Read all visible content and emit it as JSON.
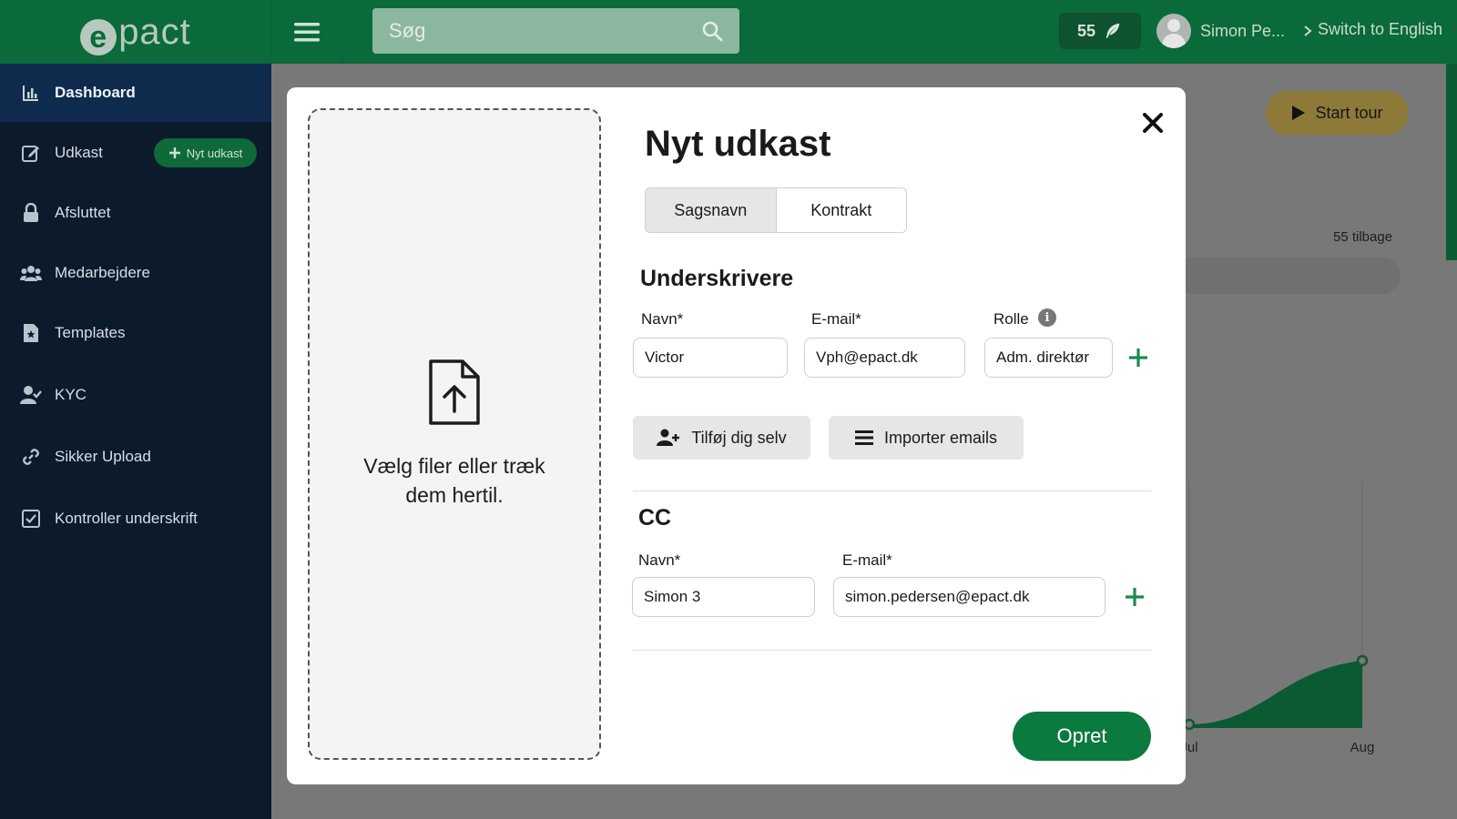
{
  "topbar": {
    "logo_text": "pact",
    "logo_mark": "e",
    "search_placeholder": "Søg",
    "credits": "55",
    "user_name": "Simon Pe...",
    "switch_language": "Switch to English"
  },
  "sidebar": {
    "items": [
      {
        "label": "Dashboard",
        "icon": "bar-chart-icon"
      },
      {
        "label": "Udkast",
        "icon": "edit-icon"
      },
      {
        "label": "Afsluttet",
        "icon": "lock-icon"
      },
      {
        "label": "Medarbejdere",
        "icon": "users-icon"
      },
      {
        "label": "Templates",
        "icon": "template-icon"
      },
      {
        "label": "KYC",
        "icon": "user-check-icon"
      },
      {
        "label": "Sikker Upload",
        "icon": "link-icon"
      },
      {
        "label": "Kontroller underskrift",
        "icon": "checkbox-icon"
      }
    ],
    "new_draft_button": "Nyt udkast"
  },
  "background": {
    "start_tour": "Start tour",
    "back_label": "55 tilbage",
    "chart_data": {
      "type": "area",
      "categories": [
        "Jul",
        "Aug"
      ],
      "values": [
        0,
        1
      ],
      "colors": {
        "fill": "#0b5a32",
        "line": "#0b5a32"
      }
    }
  },
  "modal": {
    "title": "Nyt udkast",
    "dropzone_text": "Vælg filer eller træk dem hertil.",
    "tabs": [
      {
        "label": "Sagsnavn",
        "active": true
      },
      {
        "label": "Kontrakt",
        "active": false
      }
    ],
    "signers": {
      "title": "Underskrivere",
      "name_label": "Navn*",
      "email_label": "E-mail*",
      "role_label": "Rolle",
      "name_value": "Victor",
      "email_value": "Vph@epact.dk",
      "role_value": "Adm. direktør"
    },
    "add_self_button": "Tilføj dig selv",
    "import_emails_button": "Importer emails",
    "cc": {
      "title": "CC",
      "name_label": "Navn*",
      "email_label": "E-mail*",
      "name_value": "Simon 3",
      "email_value": "simon.pedersen@epact.dk"
    },
    "submit_button": "Opret"
  },
  "colors": {
    "topbar": "#0b6a3a",
    "sidebar": "#0b1b2c",
    "accent_green": "#0b7a3e",
    "plus_green": "#1c8a4a"
  }
}
